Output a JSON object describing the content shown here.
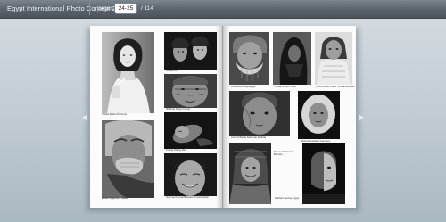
{
  "header": {
    "title": "Egypt International Photo Contest 2012",
    "pages_label": "pages:",
    "page_range": "24-25",
    "pages_total": "/ 114"
  },
  "book": {
    "left_page": {
      "captions": [
        "Chiara Bellei Piccitorto",
        "Shaofu Lin",
        "Mehmet Ozgur Fehan",
        "Kuang Sheng Ren",
        "Bilade Salgunem Halabi",
        "Gurmeed Kanal Bhaskar Puvanandran"
      ]
    },
    "right_page": {
      "captions": [
        "Amsevia Aurely-Eagle",
        "Cesar Chrom Casti",
        "Terzip Mohd Khairi Yuncal-Hamdan",
        "Amel Zulheila Sahomar Abdulai",
        "Debrun Laukaut Germany",
        "Saber Al Shamma Bahrain",
        "Haitham Henay Egypt"
      ]
    }
  },
  "colors": {
    "toolbar": "#59626b",
    "background": "#bfcad2",
    "page": "#fbfbfb"
  }
}
